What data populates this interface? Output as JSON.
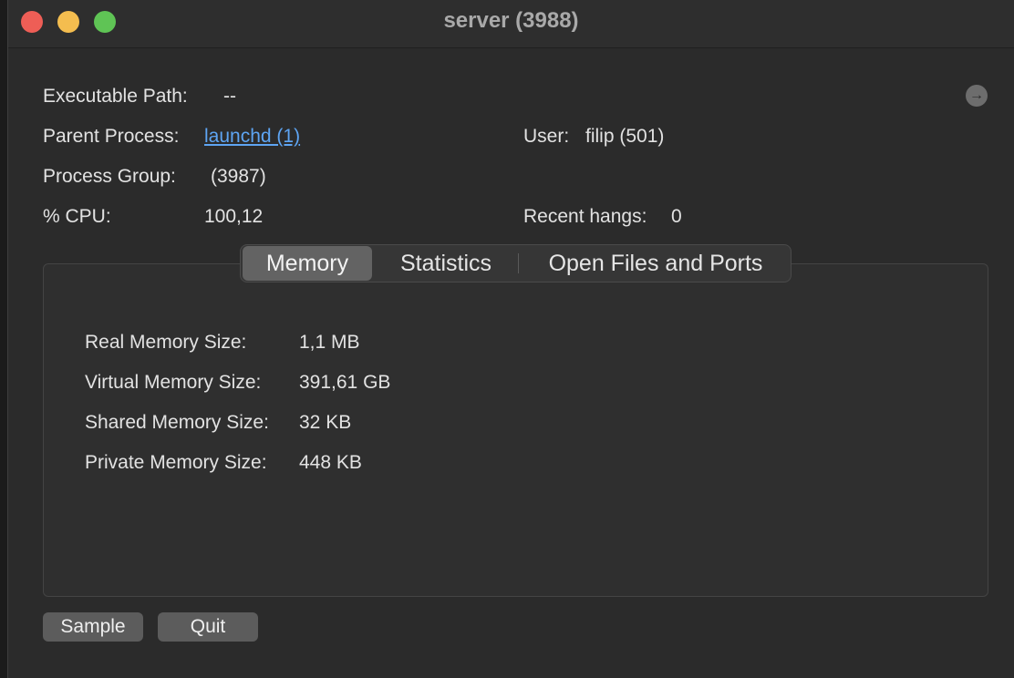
{
  "window": {
    "title": "server (3988)"
  },
  "details": {
    "executable_path_label": "Executable Path:",
    "executable_path_value": "--",
    "parent_process_label": "Parent Process:",
    "parent_process_value": "launchd (1)",
    "user_label": "User:",
    "user_value": "filip (501)",
    "process_group_label": "Process Group:",
    "process_group_value": "(3987)",
    "cpu_label": "% CPU:",
    "cpu_value": "100,12",
    "recent_hangs_label": "Recent hangs:",
    "recent_hangs_value": "0"
  },
  "tabs": [
    {
      "label": "Memory",
      "active": true
    },
    {
      "label": "Statistics",
      "active": false
    },
    {
      "label": "Open Files and Ports",
      "active": false
    }
  ],
  "memory": {
    "real_label": "Real Memory Size:",
    "real_value": "1,1 MB",
    "virtual_label": "Virtual Memory Size:",
    "virtual_value": "391,61 GB",
    "shared_label": "Shared Memory Size:",
    "shared_value": "32 KB",
    "private_label": "Private Memory Size:",
    "private_value": "448 KB"
  },
  "buttons": {
    "sample": "Sample",
    "quit": "Quit"
  },
  "icons": {
    "reveal": "arrow-right-circle-icon"
  }
}
